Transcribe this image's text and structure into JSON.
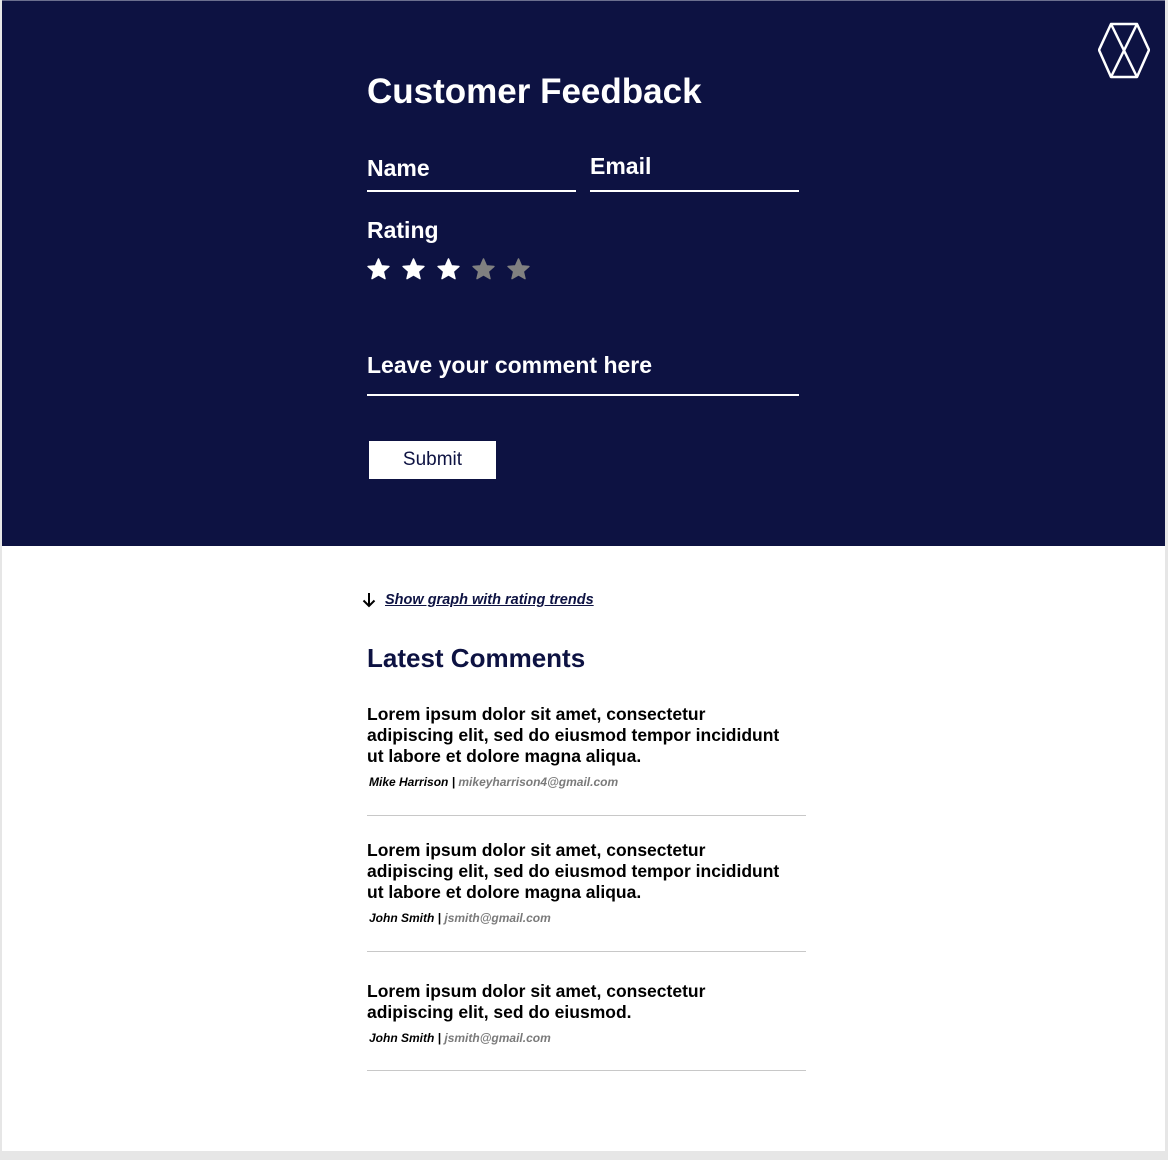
{
  "header": {
    "title": "Customer Feedback",
    "logo_icon": "hexagon-x-logo-icon"
  },
  "form": {
    "name_label": "Name",
    "email_label": "Email",
    "rating_label": "Rating",
    "rating": {
      "value": 3,
      "max": 5
    },
    "comment_label": "Leave your comment here",
    "submit_label": "Submit"
  },
  "trends": {
    "icon": "arrow-down-icon",
    "link_label": "Show graph with rating trends"
  },
  "comments": {
    "title": "Latest Comments",
    "items": [
      {
        "text": "Lorem ipsum dolor sit amet, consectetur adipiscing elit, sed do eiusmod tempor incididunt ut labore et dolore magna aliqua.",
        "author": "Mike Harrison",
        "separator": " | ",
        "email": "mikeyharrison4@gmail.com"
      },
      {
        "text": "Lorem ipsum dolor sit amet, consectetur adipiscing elit, sed do eiusmod tempor incididunt ut labore et dolore magna aliqua.",
        "author": "John Smith",
        "separator": " | ",
        "email": "jsmith@gmail.com"
      },
      {
        "text": "Lorem ipsum dolor sit amet, consectetur adipiscing elit, sed do eiusmod.",
        "author": "John Smith",
        "separator": " | ",
        "email": "jsmith@gmail.com"
      }
    ]
  },
  "colors": {
    "navy": "#0d1242",
    "star_filled": "#ffffff",
    "star_empty": "#808080",
    "email_gray": "#7a7a7a",
    "divider": "#c8c8c8"
  }
}
